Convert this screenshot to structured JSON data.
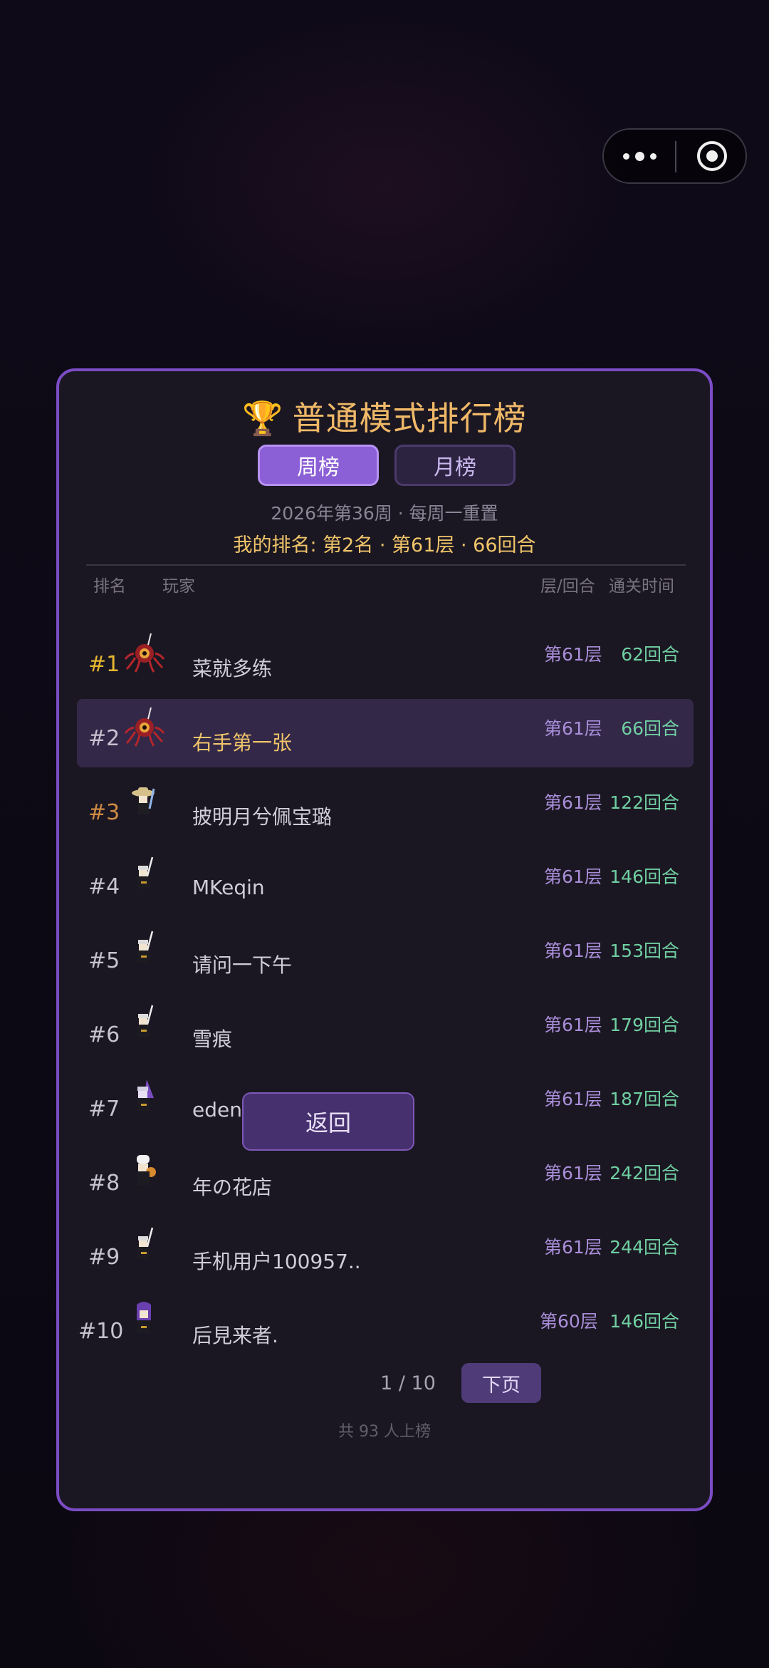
{
  "capsule": {
    "more_icon": "more-dots-icon",
    "close_icon": "close-circle-icon"
  },
  "leaderboard": {
    "title": "普通模式排行榜",
    "trophy_icon": "trophy-icon",
    "tabs": [
      {
        "label": "周榜",
        "active": true
      },
      {
        "label": "月榜",
        "active": false
      }
    ],
    "week_info": "2026年第36周 · 每周一重置",
    "my_rank": "我的排名: 第2名 · 第61层 · 66回合",
    "headers": {
      "rank": "排名",
      "player": "玩家",
      "floor_round": "层/回合",
      "clear_time": "通关时间"
    },
    "rows": [
      {
        "rank": "#1",
        "name": "菜就多练",
        "floor": "第61层",
        "rounds": "62回合",
        "avatar": "red-eye-monster-avatar"
      },
      {
        "rank": "#2",
        "name": "右手第一张",
        "floor": "第61层",
        "rounds": "66回合",
        "avatar": "red-eye-monster-avatar",
        "is_me": true
      },
      {
        "rank": "#3",
        "name": "披明月兮佩宝璐",
        "floor": "第61层",
        "rounds": "122回合",
        "avatar": "hat-swordsman-avatar"
      },
      {
        "rank": "#4",
        "name": "MKeqin",
        "floor": "第61层",
        "rounds": "146回合",
        "avatar": "swordsman-avatar"
      },
      {
        "rank": "#5",
        "name": "请问一下午",
        "floor": "第61层",
        "rounds": "153回合",
        "avatar": "swordsman-avatar"
      },
      {
        "rank": "#6",
        "name": "雪痕",
        "floor": "第61层",
        "rounds": "179回合",
        "avatar": "swordsman-avatar"
      },
      {
        "rank": "#7",
        "name": "eden",
        "floor": "第61层",
        "rounds": "187回合",
        "avatar": "purple-mage-avatar"
      },
      {
        "rank": "#8",
        "name": "年の花店",
        "floor": "第61层",
        "rounds": "242回合",
        "avatar": "chef-avatar"
      },
      {
        "rank": "#9",
        "name": "手机用户100957..",
        "floor": "第61层",
        "rounds": "244回合",
        "avatar": "swordsman-avatar"
      },
      {
        "rank": "#10",
        "name": "后見来者.",
        "floor": "第60层",
        "rounds": "146回合",
        "avatar": "purple-hood-avatar"
      }
    ],
    "pager": {
      "text": "1 / 10",
      "next_label": "下页"
    },
    "total": "共 93 人上榜",
    "back_label": "返回"
  },
  "colors": {
    "accent": "#7b4cc4",
    "gold": "#e6b830",
    "rounds_green": "#6fcfa2",
    "floor_purple": "#a98ed9"
  }
}
